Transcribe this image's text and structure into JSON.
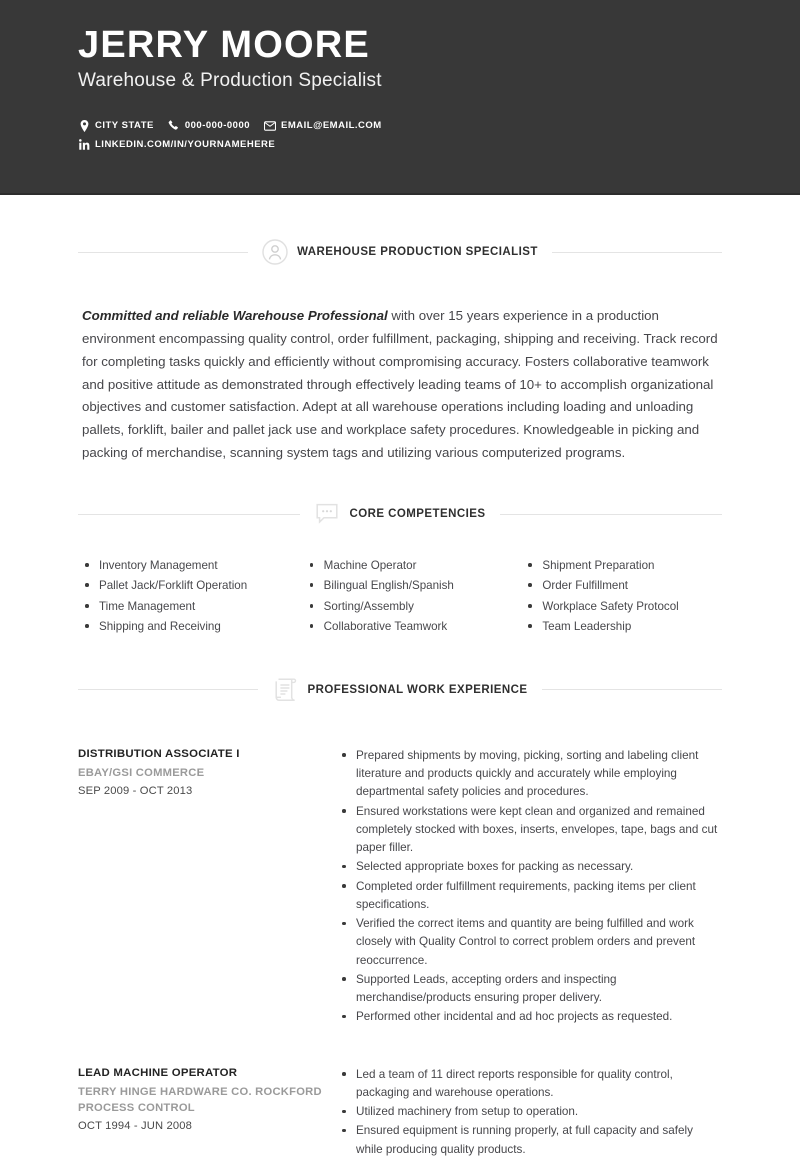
{
  "header": {
    "name": "JERRY MOORE",
    "title": "Warehouse & Production Specialist",
    "accent_color": "#383838",
    "contacts": [
      {
        "icon": "location-pin-icon",
        "text": "CITY STATE"
      },
      {
        "icon": "phone-icon",
        "text": "000-000-0000"
      },
      {
        "icon": "envelope-icon",
        "text": "EMAIL@EMAIL.COM"
      }
    ],
    "linkedin": {
      "icon": "linkedin-icon",
      "text": "LINKEDIN.COM/IN/YOURNAMEHERE"
    }
  },
  "sections": {
    "summary": {
      "icon": "person-circle-icon",
      "heading": "WAREHOUSE PRODUCTION SPECIALIST",
      "lead": "Committed and reliable Warehouse Professional",
      "body": " with over 15 years experience in a production environment encompassing quality control, order fulfillment, packaging, shipping and receiving. Track record for completing tasks quickly and efficiently without compromising accuracy. Fosters collaborative teamwork and positive attitude as demonstrated through effectively leading teams of 10+ to accomplish organizational objectives and customer satisfaction. Adept at all warehouse operations including loading and unloading pallets, forklift, bailer and pallet jack use and workplace safety procedures. Knowledgeable in picking and packing of merchandise, scanning system tags and utilizing various computerized programs."
    },
    "competencies": {
      "icon": "speech-bubble-icon",
      "heading": "CORE COMPETENCIES",
      "columns": [
        [
          "Inventory Management",
          "Pallet Jack/Forklift Operation",
          "Time Management",
          "Shipping and Receiving"
        ],
        [
          "Machine Operator",
          "Bilingual English/Spanish",
          "Sorting/Assembly",
          "Collaborative Teamwork"
        ],
        [
          "Shipment Preparation",
          "Order Fulfillment",
          "Workplace Safety Protocol",
          "Team Leadership"
        ]
      ]
    },
    "experience": {
      "icon": "scroll-document-icon",
      "heading": "PROFESSIONAL WORK EXPERIENCE",
      "jobs": [
        {
          "role": "DISTRIBUTION ASSOCIATE I",
          "company": "EBAY/GSI COMMERCE",
          "dates": "SEP 2009 - OCT 2013",
          "bullets": [
            "Prepared shipments by moving, picking, sorting and labeling client literature and products quickly and accurately while employing departmental safety policies and procedures.",
            "Ensured workstations were kept clean and organized and remained completely stocked with boxes, inserts, envelopes, tape, bags and cut paper filler.",
            "Selected appropriate boxes for packing as necessary.",
            "Completed order fulfillment requirements, packing items per client specifications.",
            "Verified the correct items and quantity are being fulfilled and work closely with Quality Control to correct problem orders and prevent reoccurrence.",
            "Supported Leads, accepting orders and inspecting merchandise/products ensuring proper delivery.",
            "Performed other incidental and ad hoc projects as requested."
          ]
        },
        {
          "role": "LEAD MACHINE OPERATOR",
          "company": "TERRY HINGE HARDWARE CO. ROCKFORD PROCESS CONTROL",
          "dates": "OCT 1994 - JUN 2008",
          "bullets": [
            "Led a team of 11 direct reports responsible for quality control, packaging and warehouse operations.",
            "Utilized machinery from setup to operation.",
            "Ensured equipment is running properly, at full capacity and safely while producing quality products."
          ]
        }
      ]
    }
  }
}
